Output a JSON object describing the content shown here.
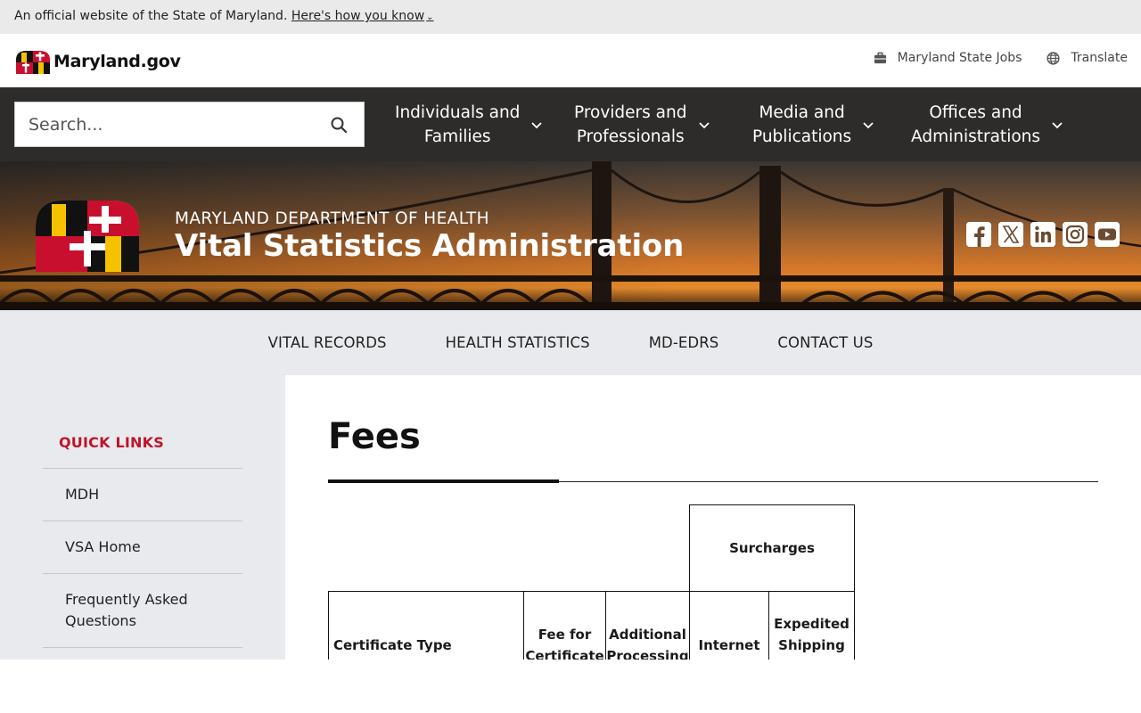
{
  "official_banner": {
    "text": "An official website of the State of Maryland.",
    "link": "Here's how you know",
    "chevron": "⌄"
  },
  "header": {
    "logo_text": "Maryland.gov",
    "links": [
      {
        "label": "Maryland State Jobs",
        "icon": "briefcase-icon"
      },
      {
        "label": "Translate",
        "icon": "globe-icon"
      }
    ]
  },
  "search": {
    "placeholder": "Search..."
  },
  "main_nav": [
    {
      "line1": "Individuals and",
      "line2": "Families"
    },
    {
      "line1": "Providers and",
      "line2": "Professionals"
    },
    {
      "line1": "Media and",
      "line2": "Publications"
    },
    {
      "line1": "Offices and",
      "line2": "Administrations"
    }
  ],
  "hero": {
    "department": "MARYLAND DEPARTMENT OF HEALTH",
    "agency": "Vital Statistics Administration",
    "social": [
      "facebook-icon",
      "x-twitter-icon",
      "linkedin-icon",
      "instagram-icon",
      "youtube-icon"
    ]
  },
  "sub_nav": [
    "VITAL RECORDS",
    "HEALTH STATISTICS",
    "MD-EDRS",
    "CONTACT US"
  ],
  "sidebar": {
    "title": "QUICK LINKS",
    "items": [
      "MDH",
      "VSA Home",
      "Frequently Asked Questions"
    ]
  },
  "content": {
    "title": "Fees",
    "table": {
      "group_header": "Surcharges",
      "columns": [
        "Certificate Type",
        "Fee for Certificate",
        "Additional Processing",
        "Internet",
        "Expedited Shipping (only for"
      ]
    }
  },
  "colors": {
    "official_bar": "#eaeaea",
    "nav_dark": "#2d2c2a",
    "subnav_bg": "#e8eaed",
    "quick_links_red": "#c0142a"
  }
}
